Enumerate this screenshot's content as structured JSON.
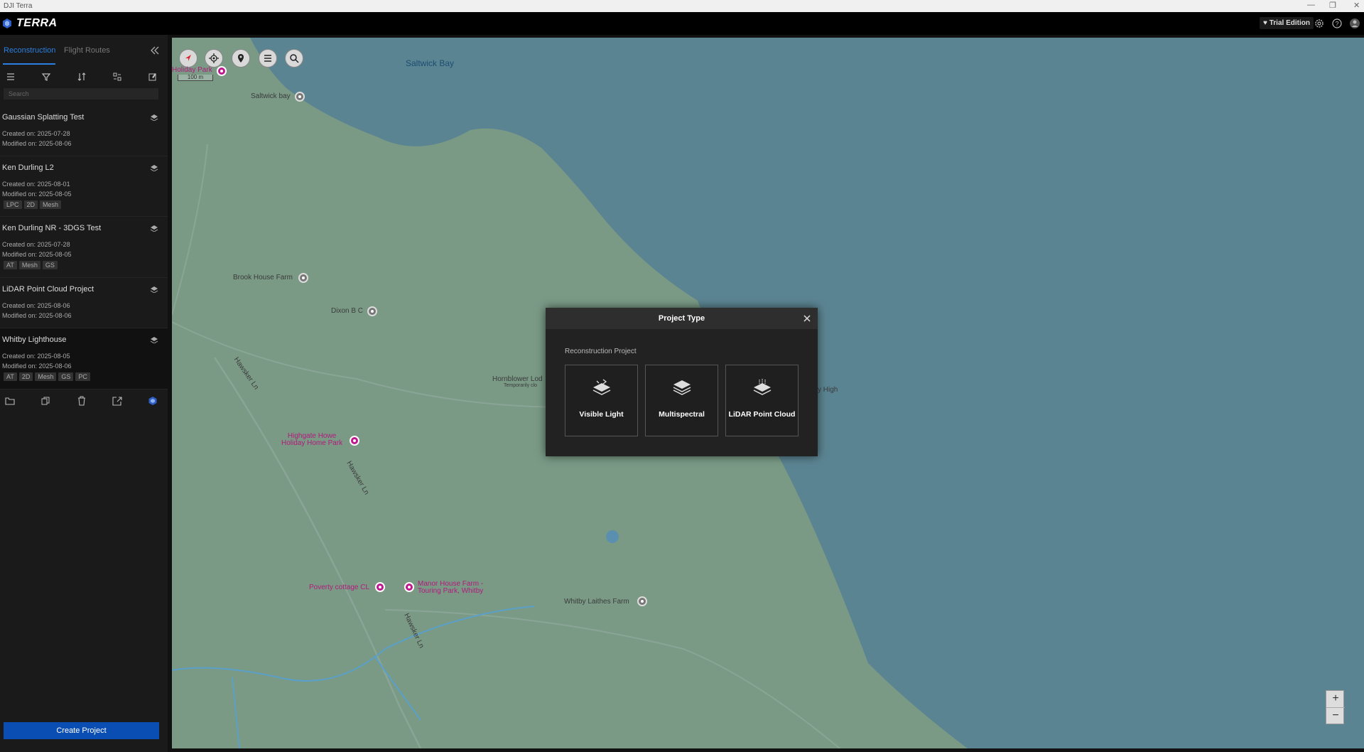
{
  "window": {
    "title": "DJI Terra"
  },
  "app": {
    "brand": "TERRA",
    "trial_label": "Trial Edition"
  },
  "tabs": {
    "reconstruction": "Reconstruction",
    "flight_routes": "Flight Routes"
  },
  "search": {
    "placeholder": "Search"
  },
  "projects": [
    {
      "name": "Gaussian Splatting Test",
      "created": "Created on: 2025-07-28",
      "modified": "Modified on: 2025-08-06",
      "tags": []
    },
    {
      "name": "Ken Durling L2",
      "created": "Created on: 2025-08-01",
      "modified": "Modified on: 2025-08-05",
      "tags": [
        "LPC",
        "2D",
        "Mesh"
      ]
    },
    {
      "name": "Ken Durling NR - 3DGS Test",
      "created": "Created on: 2025-07-28",
      "modified": "Modified on: 2025-08-05",
      "tags": [
        "AT",
        "Mesh",
        "GS"
      ]
    },
    {
      "name": "LiDAR Point Cloud Project",
      "created": "Created on: 2025-08-06",
      "modified": "Modified on: 2025-08-06",
      "tags": []
    },
    {
      "name": "Whitby Lighthouse",
      "created": "Created on: 2025-08-05",
      "modified": "Modified on: 2025-08-06",
      "tags": [
        "AT",
        "2D",
        "Mesh",
        "GS",
        "PC"
      ]
    }
  ],
  "create_button": "Create Project",
  "map": {
    "scale": "100 m",
    "labels": {
      "saltwick_bay_water": "Saltwick Bay",
      "holiday_park": "Holiday Park",
      "saltwick_bay": "Saltwick bay",
      "brook_house": "Brook House Farm",
      "dixon": "Dixon B C",
      "hornblower": "Hornblower Lod",
      "hornblower_sub": "Temporarily clo",
      "high": "y High",
      "highgate": "Highgate Howe\nHoliday Home Park",
      "hawsker1": "Hawsker Ln",
      "hawsker2": "Hawsker Ln",
      "hawsker3": "Hawsker Ln",
      "poverty": "Poverty cottage CL",
      "manor": "Manor House Farm -\nTouring Park, Whitby",
      "whitby_laithes": "Whitby Laithes Farm"
    }
  },
  "dialog": {
    "title": "Project Type",
    "subtitle": "Reconstruction Project",
    "options": [
      "Visible Light",
      "Multispectral",
      "LiDAR Point Cloud"
    ]
  }
}
